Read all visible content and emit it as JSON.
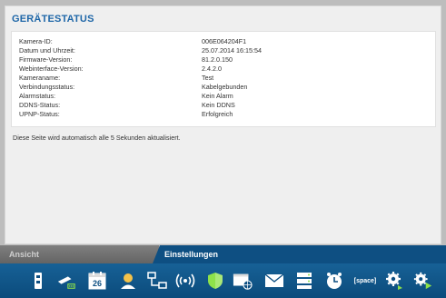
{
  "header": {
    "title": "GERÄTESTATUS"
  },
  "status": [
    {
      "label": "Kamera-ID:",
      "value": "006E064204F1"
    },
    {
      "label": "Datum und Uhrzeit:",
      "value": "25.07.2014 16:15:54"
    },
    {
      "label": "Firmware-Version:",
      "value": "81.2.0.150"
    },
    {
      "label": "Webinterface-Version:",
      "value": "2.4.2.0"
    },
    {
      "label": "Kameraname:",
      "value": "Test"
    },
    {
      "label": "Verbindungsstatus:",
      "value": "Kabelgebunden"
    },
    {
      "label": "Alarmstatus:",
      "value": "Kein Alarm"
    },
    {
      "label": "DDNS-Status:",
      "value": "Kein DDNS"
    },
    {
      "label": "UPNP-Status:",
      "value": "Erfolgreich"
    }
  ],
  "refresh_note": "Diese Seite wird automatisch alle 5 Sekunden aktualisiert.",
  "tabs": {
    "left": "Ansicht",
    "right": "Einstellungen"
  },
  "toolbar": {
    "calendar_day": "26",
    "space_label": "[space]",
    "icons": [
      "device-info-icon",
      "network-cable-icon",
      "calendar-icon",
      "user-icon",
      "network-topology-icon",
      "wireless-icon",
      "security-shield-icon",
      "browser-icon",
      "email-icon",
      "storage-icon",
      "clock-icon",
      "space-icon",
      "settings-gear-icon",
      "settings-advanced-icon"
    ]
  },
  "colors": {
    "title": "#1f67a8",
    "tab_active": "#0e4f82",
    "tab_inactive": "#6f6f6f",
    "icon_accent": "#8ee14a",
    "toolbar": "#11568a"
  }
}
